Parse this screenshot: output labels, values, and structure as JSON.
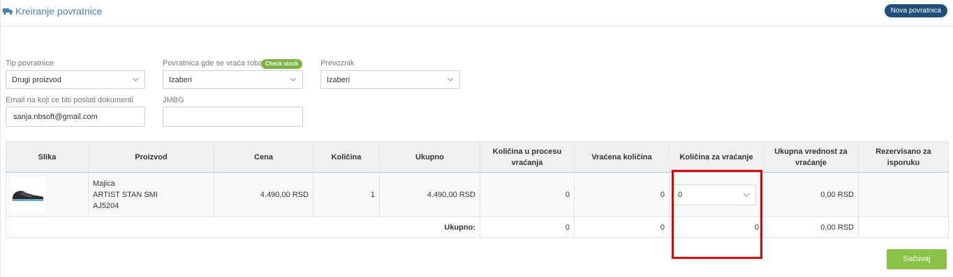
{
  "header": {
    "title": "Kreiranje povratnice",
    "new_button": "Nova povratnica"
  },
  "form": {
    "return_type": {
      "label": "Tip povratnice",
      "value": "Drugi proizvod"
    },
    "return_location": {
      "label": "Povratnica gde se vraća roba",
      "value": "Izaberi",
      "badge": "Check stock"
    },
    "carrier": {
      "label": "Prevoznik",
      "value": "Izaberi"
    },
    "email": {
      "label": "Email na koji ce biti poslati dokumenti",
      "value": "sanja.nbsoft@gmail.com"
    },
    "jmbg": {
      "label": "JMBG",
      "value": ""
    }
  },
  "table": {
    "columns": [
      "Slika",
      "Proizvod",
      "Cena",
      "Količina",
      "Ukupno",
      "Količina u procesu vraćanja",
      "Vraćena količina",
      "Količina za vraćanje",
      "Ukupna vrednost za vraćanje",
      "Rezervisano za isporuku"
    ],
    "rows": [
      {
        "product_name": "Majica",
        "product_brand": "ARTIST STAN SMI",
        "product_code": "AJ5204",
        "price": "4.490,00 RSD",
        "quantity": "1",
        "total": "4.490,00 RSD",
        "in_process": "0",
        "returned": "0",
        "to_return": "0",
        "return_value": "0,00 RSD",
        "reserved": ""
      }
    ],
    "summary": {
      "label": "Ukupno:",
      "in_process": "0",
      "returned": "0",
      "to_return": "0",
      "return_value": "0,00 RSD",
      "reserved": ""
    }
  },
  "save_button": "Sačuvaj",
  "colors": {
    "accent": "#1f4e79",
    "save": "#8bc34a",
    "badge": "#7cb342",
    "highlight": "#e00000"
  }
}
